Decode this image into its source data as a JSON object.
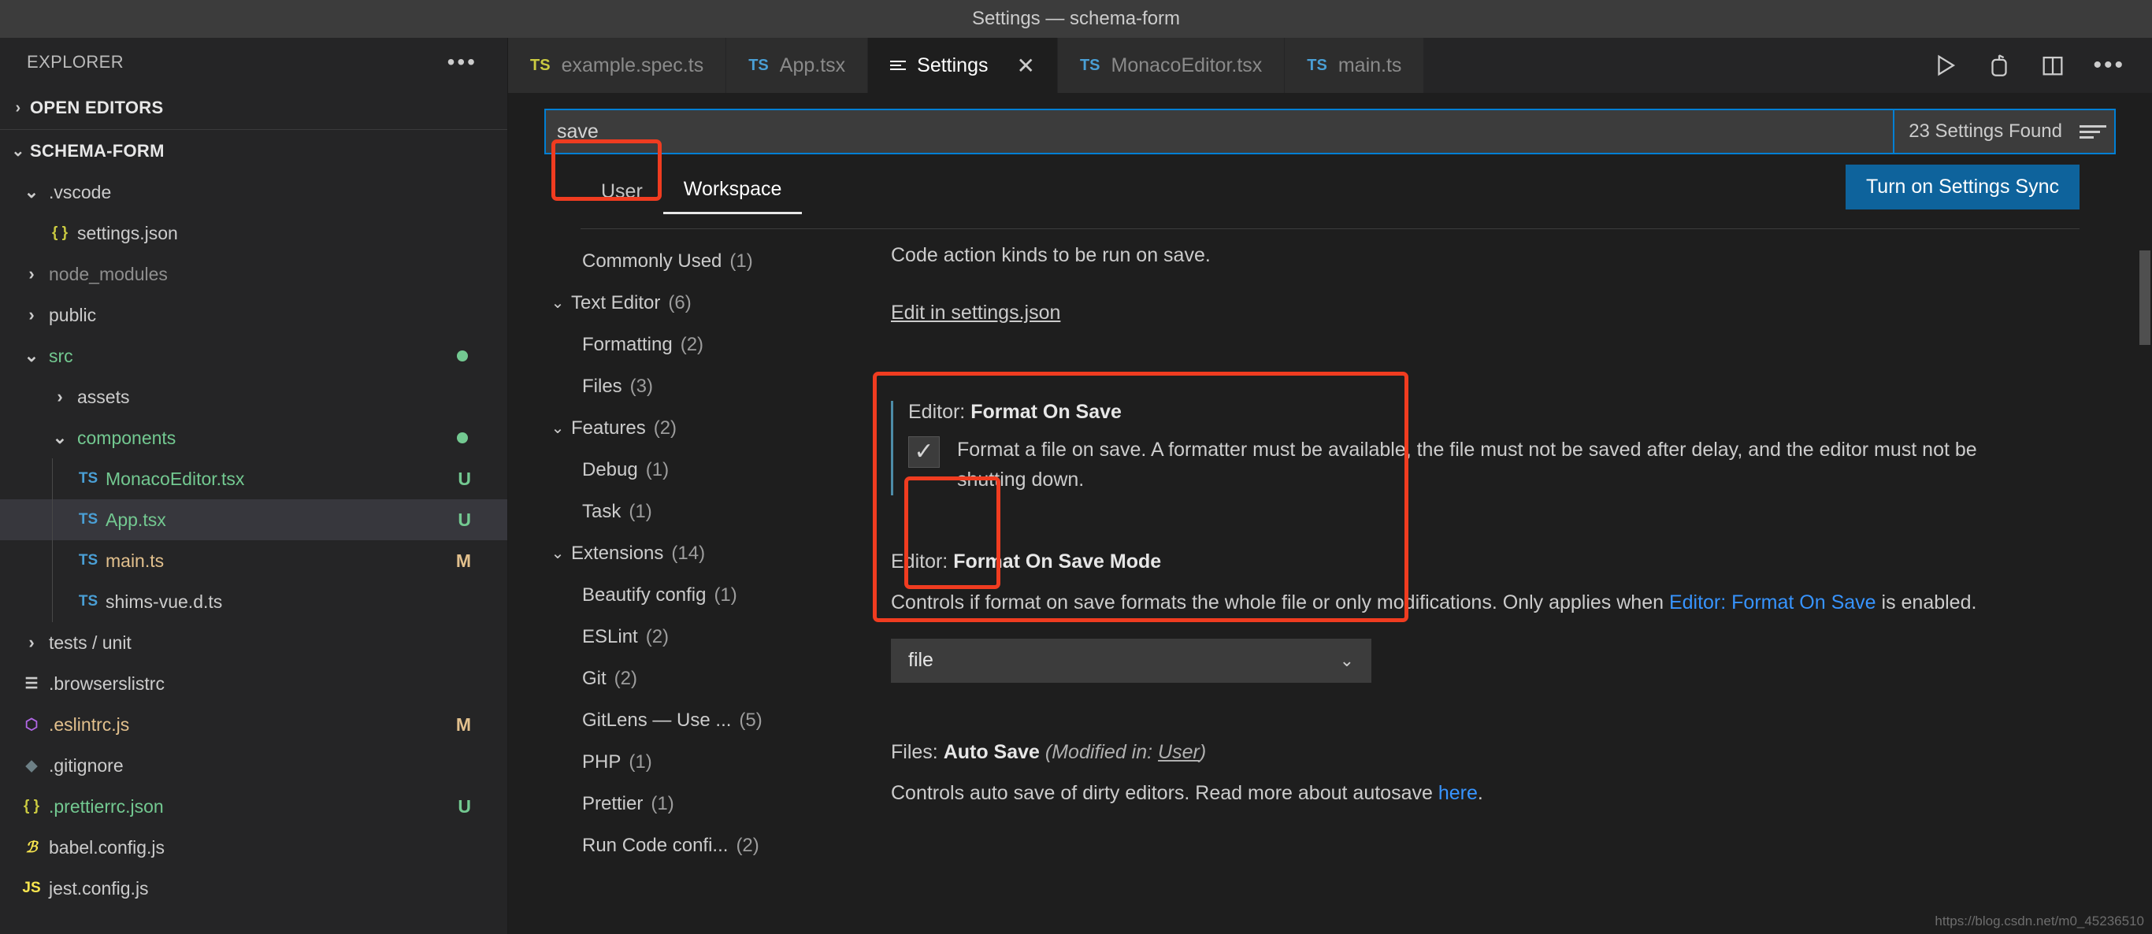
{
  "window": {
    "title": "Settings — schema-form"
  },
  "sidebar": {
    "header": {
      "label": "EXPLORER",
      "more_icon": "more-icon"
    },
    "open_editors": {
      "label": "OPEN EDITORS"
    },
    "project": {
      "label": "SCHEMA-FORM"
    },
    "tree": [
      {
        "label": ".vscode",
        "type": "folder",
        "expanded": true,
        "depth": 1,
        "icon": "chevron-down-icon",
        "color": "#cccccc"
      },
      {
        "label": "settings.json",
        "type": "file",
        "depth": 2,
        "icon": "{}",
        "icon_color": "#cbcb41",
        "color": "#cccccc"
      },
      {
        "label": "node_modules",
        "type": "folder",
        "expanded": false,
        "depth": 1,
        "icon": "chevron-right-icon",
        "color": "#8e8e8e"
      },
      {
        "label": "public",
        "type": "folder",
        "expanded": false,
        "depth": 1,
        "icon": "chevron-right-icon",
        "color": "#cccccc"
      },
      {
        "label": "src",
        "type": "folder",
        "expanded": true,
        "depth": 1,
        "icon": "chevron-down-icon",
        "color": "#73c991",
        "dot": true
      },
      {
        "label": "assets",
        "type": "folder",
        "expanded": false,
        "depth": 2,
        "icon": "chevron-right-icon",
        "color": "#cccccc"
      },
      {
        "label": "components",
        "type": "folder",
        "expanded": true,
        "depth": 2,
        "icon": "chevron-down-icon",
        "color": "#73c991",
        "dot": true
      },
      {
        "label": "MonacoEditor.tsx",
        "type": "file",
        "depth": 3,
        "icon": "TS",
        "icon_color": "#4a9fd5",
        "color": "#73c991",
        "status": "U",
        "status_color": "#73c991"
      },
      {
        "label": "App.tsx",
        "type": "file",
        "depth": 3,
        "icon": "TS",
        "icon_color": "#4a9fd5",
        "color": "#73c991",
        "status": "U",
        "status_color": "#73c991",
        "selected": true
      },
      {
        "label": "main.ts",
        "type": "file",
        "depth": 3,
        "icon": "TS",
        "icon_color": "#4a9fd5",
        "color": "#e2c08d",
        "status": "M",
        "status_color": "#e2c08d"
      },
      {
        "label": "shims-vue.d.ts",
        "type": "file",
        "depth": 3,
        "icon": "TS",
        "icon_color": "#4a9fd5",
        "color": "#cccccc"
      },
      {
        "label": "tests / unit",
        "type": "folder",
        "expanded": false,
        "depth": 1,
        "icon": "chevron-right-icon",
        "color": "#cccccc"
      },
      {
        "label": ".browserslistrc",
        "type": "file",
        "depth": 1,
        "icon": "lines-icon",
        "icon_color": "#cccccc",
        "color": "#cccccc"
      },
      {
        "label": ".eslintrc.js",
        "type": "file",
        "depth": 1,
        "icon": "eslint-icon",
        "icon_color": "#b267e6",
        "color": "#e2c08d",
        "status": "M",
        "status_color": "#e2c08d"
      },
      {
        "label": ".gitignore",
        "type": "file",
        "depth": 1,
        "icon": "git-icon",
        "icon_color": "#6d8086",
        "color": "#cccccc"
      },
      {
        "label": ".prettierrc.json",
        "type": "file",
        "depth": 1,
        "icon": "{}",
        "icon_color": "#cbcb41",
        "color": "#73c991",
        "status": "U",
        "status_color": "#73c991"
      },
      {
        "label": "babel.config.js",
        "type": "file",
        "depth": 1,
        "icon": "B",
        "icon_color": "#f9e64f",
        "color": "#cccccc"
      },
      {
        "label": "jest.config.js",
        "type": "file",
        "depth": 1,
        "icon": "JS",
        "icon_color": "#f9e64f",
        "color": "#cccccc"
      }
    ]
  },
  "tabs": [
    {
      "label": "example.spec.ts",
      "icon": "TS",
      "icon_class": "yellow",
      "active": false,
      "closable": false
    },
    {
      "label": "App.tsx",
      "icon": "TS",
      "icon_class": "",
      "active": false,
      "closable": false
    },
    {
      "label": "Settings",
      "icon": "settings-icon",
      "icon_class": "",
      "active": true,
      "closable": true
    },
    {
      "label": "MonacoEditor.tsx",
      "icon": "TS",
      "icon_class": "",
      "active": false,
      "closable": false
    },
    {
      "label": "main.ts",
      "icon": "TS",
      "icon_class": "",
      "active": false,
      "closable": false
    }
  ],
  "tab_actions": [
    {
      "name": "run-icon"
    },
    {
      "name": "run-and-debug-icon"
    },
    {
      "name": "split-editor-icon"
    },
    {
      "name": "more-actions-icon"
    }
  ],
  "settings": {
    "search": {
      "value": "save",
      "placeholder": "Search settings"
    },
    "results_count": "23 Settings Found",
    "filter_icon": "filter-icon",
    "scope_tabs": [
      {
        "label": "User",
        "active": false
      },
      {
        "label": "Workspace",
        "active": true
      }
    ],
    "sync_button": "Turn on Settings Sync",
    "toc": [
      {
        "label": "Commonly Used",
        "count": "(1)",
        "level": 1,
        "twisty": ""
      },
      {
        "label": "Text Editor",
        "count": "(6)",
        "level": 0,
        "twisty": "chevron-down-icon"
      },
      {
        "label": "Formatting",
        "count": "(2)",
        "level": 1,
        "twisty": ""
      },
      {
        "label": "Files",
        "count": "(3)",
        "level": 1,
        "twisty": ""
      },
      {
        "label": "Features",
        "count": "(2)",
        "level": 0,
        "twisty": "chevron-down-icon"
      },
      {
        "label": "Debug",
        "count": "(1)",
        "level": 1,
        "twisty": ""
      },
      {
        "label": "Task",
        "count": "(1)",
        "level": 1,
        "twisty": ""
      },
      {
        "label": "Extensions",
        "count": "(14)",
        "level": 0,
        "twisty": "chevron-down-icon"
      },
      {
        "label": "Beautify config",
        "count": "(1)",
        "level": 1,
        "twisty": ""
      },
      {
        "label": "ESLint",
        "count": "(2)",
        "level": 1,
        "twisty": ""
      },
      {
        "label": "Git",
        "count": "(2)",
        "level": 1,
        "twisty": ""
      },
      {
        "label": "GitLens — Use ...",
        "count": "(5)",
        "level": 1,
        "twisty": ""
      },
      {
        "label": "PHP",
        "count": "(1)",
        "level": 1,
        "twisty": ""
      },
      {
        "label": "Prettier",
        "count": "(1)",
        "level": 1,
        "twisty": ""
      },
      {
        "label": "Run Code confi...",
        "count": "(2)",
        "level": 1,
        "twisty": ""
      }
    ],
    "content": {
      "code_action_desc": "Code action kinds to be run on save.",
      "edit_in_json_link": "Edit in settings.json",
      "format_on_save": {
        "title_prefix": "Editor:",
        "title_name": "Format On Save",
        "checkbox_checked": true,
        "check_glyph": "✓",
        "description": "Format a file on save. A formatter must be available, the file must not be saved after delay, and the editor must not be shutting down."
      },
      "format_on_save_mode": {
        "title_prefix": "Editor:",
        "title_name": "Format On Save Mode",
        "desc_part1": "Controls if format on save formats the whole file or only modifications. Only applies when ",
        "desc_link": "Editor: Format On Save",
        "desc_part2": " is enabled.",
        "select_value": "file",
        "chevron": "chevron-down-icon"
      },
      "auto_save": {
        "title_prefix": "Files:",
        "title_name": "Auto Save",
        "modified_prefix": "(Modified in: ",
        "modified_scope": "User",
        "modified_suffix": ")",
        "desc_part1": "Controls auto save of dirty editors. Read more about autosave ",
        "desc_link": "here",
        "desc_part2": "."
      }
    }
  },
  "annotations": [
    {
      "name": "search-field-highlight",
      "color": "#f03c20"
    },
    {
      "name": "format-on-save-setting-highlight",
      "color": "#f03c20"
    },
    {
      "name": "format-on-save-checkbox-highlight",
      "color": "#f03c20"
    }
  ],
  "watermark": "https://blog.csdn.net/m0_45236510"
}
